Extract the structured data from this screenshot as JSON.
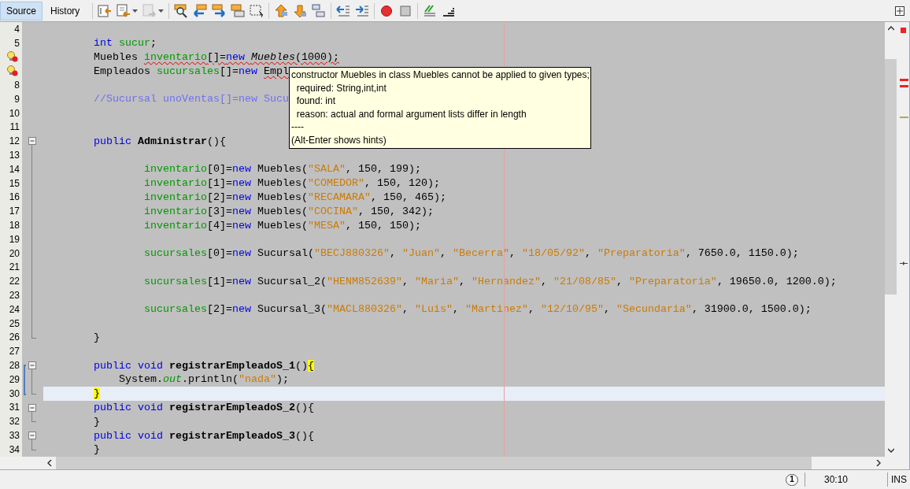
{
  "tabs": [
    {
      "label": "Source",
      "selected": true
    },
    {
      "label": "History",
      "selected": false
    }
  ],
  "lines": [
    {
      "number": "4",
      "kind": "flat",
      "error": false,
      "scope": false,
      "current": false
    },
    {
      "number": "5",
      "kind": "flat",
      "error": false,
      "scope": false,
      "current": false,
      "tokens": [
        {
          "text": "        int ",
          "kind": "kw"
        },
        {
          "text": "sucur",
          "kind": "field"
        },
        {
          "text": ";",
          "kind": "plain"
        }
      ]
    },
    {
      "kind": "flat",
      "error": true,
      "scope": false,
      "current": false,
      "tokens": [
        {
          "text": "        Muebles ",
          "kind": "plain"
        },
        {
          "kind": "error",
          "parts": [
            {
              "text": "inventario",
              "kind": "field"
            },
            {
              "text": "[]=",
              "kind": "plain"
            },
            {
              "text": "new ",
              "kind": "kw"
            },
            {
              "text": "Muebles",
              "kind": "italic"
            },
            {
              "text": "(1000);",
              "kind": "plain"
            }
          ]
        }
      ]
    },
    {
      "kind": "flat",
      "error": true,
      "scope": false,
      "current": false,
      "tokens": [
        {
          "text": "        Empleados ",
          "kind": "plain"
        },
        {
          "text": "sucursales",
          "kind": "field"
        },
        {
          "text": "[]=",
          "kind": "plain"
        },
        {
          "text": "new ",
          "kind": "kw"
        },
        {
          "kind": "error",
          "parts": [
            {
              "text": "Empl",
              "kind": "plain"
            }
          ]
        }
      ]
    },
    {
      "number": "8",
      "kind": "flat",
      "error": false,
      "scope": false,
      "current": false
    },
    {
      "number": "9",
      "kind": "flat",
      "error": false,
      "scope": false,
      "current": false,
      "tokens": [
        {
          "text": "        //Sucursal unoVentas[]=new Sucu",
          "kind": "comment"
        }
      ]
    },
    {
      "number": "10",
      "kind": "flat",
      "error": false,
      "scope": false,
      "current": false
    },
    {
      "number": "11",
      "kind": "flat",
      "error": false,
      "scope": false,
      "current": false
    },
    {
      "number": "12",
      "kind": "open",
      "error": false,
      "scope": false,
      "current": false,
      "tokens": [
        {
          "text": "        public ",
          "kind": "kw"
        },
        {
          "text": "Administrar",
          "kind": "method"
        },
        {
          "text": "(){",
          "kind": "plain"
        }
      ]
    },
    {
      "number": "13",
      "kind": "inner",
      "error": false,
      "scope": false,
      "current": false
    },
    {
      "number": "14",
      "kind": "inner",
      "error": false,
      "scope": false,
      "current": false,
      "tokens": [
        {
          "text": "                inventario",
          "kind": "field"
        },
        {
          "text": "[0]=",
          "kind": "plain"
        },
        {
          "text": "new",
          "kind": "kw"
        },
        {
          "text": " Muebles(",
          "kind": "plain"
        },
        {
          "text": "\"SALA\"",
          "kind": "str"
        },
        {
          "text": ", 150, 199);",
          "kind": "plain"
        }
      ]
    },
    {
      "number": "15",
      "kind": "inner",
      "error": false,
      "scope": false,
      "current": false,
      "tokens": [
        {
          "text": "                inventario",
          "kind": "field"
        },
        {
          "text": "[1]=",
          "kind": "plain"
        },
        {
          "text": "new",
          "kind": "kw"
        },
        {
          "text": " Muebles(",
          "kind": "plain"
        },
        {
          "text": "\"COMEDOR\"",
          "kind": "str"
        },
        {
          "text": ", 150, 120);",
          "kind": "plain"
        }
      ]
    },
    {
      "number": "16",
      "kind": "inner",
      "error": false,
      "scope": false,
      "current": false,
      "tokens": [
        {
          "text": "                inventario",
          "kind": "field"
        },
        {
          "text": "[2]=",
          "kind": "plain"
        },
        {
          "text": "new",
          "kind": "kw"
        },
        {
          "text": " Muebles(",
          "kind": "plain"
        },
        {
          "text": "\"RECAMARA\"",
          "kind": "str"
        },
        {
          "text": ", 150, 465);",
          "kind": "plain"
        }
      ]
    },
    {
      "number": "17",
      "kind": "inner",
      "error": false,
      "scope": false,
      "current": false,
      "tokens": [
        {
          "text": "                inventario",
          "kind": "field"
        },
        {
          "text": "[3]=",
          "kind": "plain"
        },
        {
          "text": "new",
          "kind": "kw"
        },
        {
          "text": " Muebles(",
          "kind": "plain"
        },
        {
          "text": "\"COCINA\"",
          "kind": "str"
        },
        {
          "text": ", 150, 342);",
          "kind": "plain"
        }
      ]
    },
    {
      "number": "18",
      "kind": "inner",
      "error": false,
      "scope": false,
      "current": false,
      "tokens": [
        {
          "text": "                inventario",
          "kind": "field"
        },
        {
          "text": "[4]=",
          "kind": "plain"
        },
        {
          "text": "new",
          "kind": "kw"
        },
        {
          "text": " Muebles(",
          "kind": "plain"
        },
        {
          "text": "\"MESA\"",
          "kind": "str"
        },
        {
          "text": ", 150, 150);",
          "kind": "plain"
        }
      ]
    },
    {
      "number": "19",
      "kind": "inner",
      "error": false,
      "scope": false,
      "current": false
    },
    {
      "number": "20",
      "kind": "inner",
      "error": false,
      "scope": false,
      "current": false,
      "tokens": [
        {
          "text": "                sucursales",
          "kind": "field"
        },
        {
          "text": "[0]=",
          "kind": "plain"
        },
        {
          "text": "new",
          "kind": "kw"
        },
        {
          "text": " Sucursal(",
          "kind": "plain"
        },
        {
          "text": "\"BECJ880326\"",
          "kind": "str"
        },
        {
          "text": ", ",
          "kind": "plain"
        },
        {
          "text": "\"Juan\"",
          "kind": "str"
        },
        {
          "text": ", ",
          "kind": "plain"
        },
        {
          "text": "\"Becerra\"",
          "kind": "str"
        },
        {
          "text": ", ",
          "kind": "plain"
        },
        {
          "text": "\"18/05/92\"",
          "kind": "str"
        },
        {
          "text": ", ",
          "kind": "plain"
        },
        {
          "text": "\"Preparatoria\"",
          "kind": "str"
        },
        {
          "text": ", 7650.0, 1150.0);",
          "kind": "plain"
        }
      ]
    },
    {
      "number": "21",
      "kind": "inner",
      "error": false,
      "scope": false,
      "current": false
    },
    {
      "number": "22",
      "kind": "inner",
      "error": false,
      "scope": false,
      "current": false,
      "tokens": [
        {
          "text": "                sucursales",
          "kind": "field"
        },
        {
          "text": "[1]=",
          "kind": "plain"
        },
        {
          "text": "new",
          "kind": "kw"
        },
        {
          "text": " Sucursal_2(",
          "kind": "plain"
        },
        {
          "text": "\"HENM852639\"",
          "kind": "str"
        },
        {
          "text": ", ",
          "kind": "plain"
        },
        {
          "text": "\"Maria\"",
          "kind": "str"
        },
        {
          "text": ", ",
          "kind": "plain"
        },
        {
          "text": "\"Hernandez\"",
          "kind": "str"
        },
        {
          "text": ", ",
          "kind": "plain"
        },
        {
          "text": "\"21/08/85\"",
          "kind": "str"
        },
        {
          "text": ", ",
          "kind": "plain"
        },
        {
          "text": "\"Preparatoria\"",
          "kind": "str"
        },
        {
          "text": ", 19650.0, 1200.0);",
          "kind": "plain"
        }
      ]
    },
    {
      "number": "23",
      "kind": "inner",
      "error": false,
      "scope": false,
      "current": false
    },
    {
      "number": "24",
      "kind": "inner",
      "error": false,
      "scope": false,
      "current": false,
      "tokens": [
        {
          "text": "                sucursales",
          "kind": "field"
        },
        {
          "text": "[2]=",
          "kind": "plain"
        },
        {
          "text": "new",
          "kind": "kw"
        },
        {
          "text": " Sucursal_3(",
          "kind": "plain"
        },
        {
          "text": "\"MACL880326\"",
          "kind": "str"
        },
        {
          "text": ", ",
          "kind": "plain"
        },
        {
          "text": "\"Luis\"",
          "kind": "str"
        },
        {
          "text": ", ",
          "kind": "plain"
        },
        {
          "text": "\"Martinez\"",
          "kind": "str"
        },
        {
          "text": ", ",
          "kind": "plain"
        },
        {
          "text": "\"12/10/95\"",
          "kind": "str"
        },
        {
          "text": ", ",
          "kind": "plain"
        },
        {
          "text": "\"Secundaria\"",
          "kind": "str"
        },
        {
          "text": ", 31900.0, 1500.0);",
          "kind": "plain"
        }
      ]
    },
    {
      "number": "25",
      "kind": "inner",
      "error": false,
      "scope": false,
      "current": false
    },
    {
      "number": "26",
      "kind": "close",
      "error": false,
      "scope": false,
      "current": false,
      "tokens": [
        {
          "text": "        }",
          "kind": "plain"
        }
      ]
    },
    {
      "number": "27",
      "kind": "flat",
      "error": false,
      "scope": false,
      "current": false
    },
    {
      "number": "28",
      "kind": "open",
      "error": false,
      "scope": true,
      "current": false,
      "tokens": [
        {
          "text": "        public void ",
          "kind": "kw"
        },
        {
          "text": "registrarEmpleadoS_1",
          "kind": "method"
        },
        {
          "text": "()",
          "kind": "plain"
        },
        {
          "text": "{",
          "kind": "match"
        }
      ]
    },
    {
      "number": "29",
      "kind": "inner",
      "error": false,
      "scope": true,
      "current": false,
      "tokens": [
        {
          "text": "            System.",
          "kind": "plain"
        },
        {
          "text": "out",
          "kind": "static"
        },
        {
          "text": ".println(",
          "kind": "plain"
        },
        {
          "text": "\"nada\"",
          "kind": "str"
        },
        {
          "text": ");",
          "kind": "plain"
        }
      ]
    },
    {
      "number": "30",
      "kind": "close",
      "error": false,
      "scope": true,
      "current": true,
      "tokens": [
        {
          "text": "        }",
          "kind": "match"
        }
      ]
    },
    {
      "number": "31",
      "kind": "open",
      "error": false,
      "scope": false,
      "current": false,
      "tokens": [
        {
          "text": "        public void ",
          "kind": "kw"
        },
        {
          "text": "registrarEmpleadoS_2",
          "kind": "method"
        },
        {
          "text": "(){",
          "kind": "plain"
        }
      ]
    },
    {
      "number": "32",
      "kind": "close",
      "error": false,
      "scope": false,
      "current": false,
      "tokens": [
        {
          "text": "        }",
          "kind": "plain"
        }
      ]
    },
    {
      "number": "33",
      "kind": "open",
      "error": false,
      "scope": false,
      "current": false,
      "tokens": [
        {
          "text": "        public void ",
          "kind": "kw"
        },
        {
          "text": "registrarEmpleadoS_3",
          "kind": "method"
        },
        {
          "text": "(){",
          "kind": "plain"
        }
      ]
    },
    {
      "number": "34",
      "kind": "close",
      "error": false,
      "scope": false,
      "current": false,
      "tokens": [
        {
          "text": "        }",
          "kind": "plain"
        }
      ]
    }
  ],
  "tooltip": {
    "lines": [
      "constructor Muebles in class Muebles cannot be applied to given types;",
      "  required: String,int,int",
      "  found: int",
      "  reason: actual and formal argument lists differ in length",
      "----",
      "(Alt-Enter shows hints)"
    ]
  },
  "status_bar": {
    "notifications": "1",
    "position": "30:10",
    "mode": "INS"
  }
}
